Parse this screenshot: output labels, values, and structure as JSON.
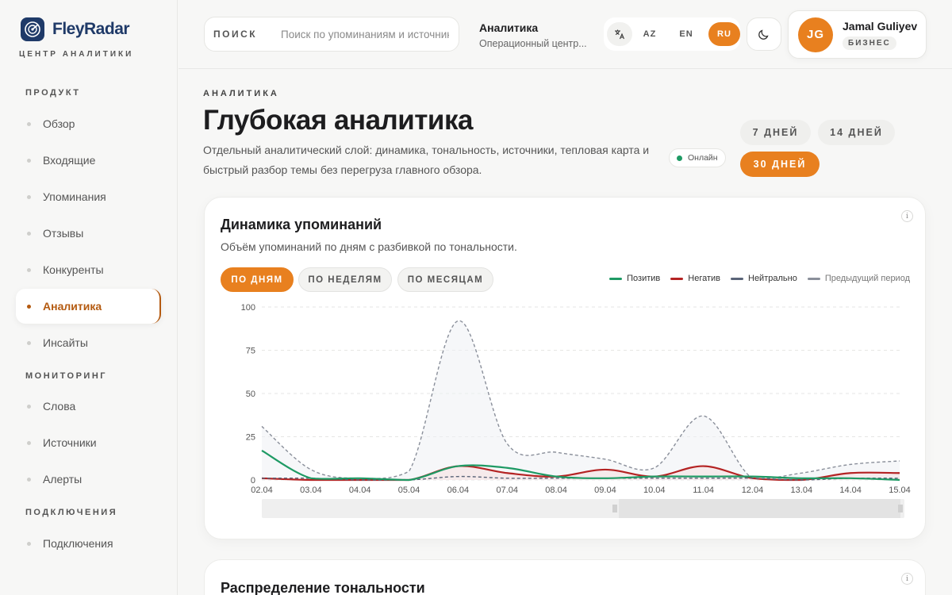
{
  "brand": {
    "name": "FleyRadar",
    "subtitle": "ЦЕНТР АНАЛИТИКИ"
  },
  "sidebar": {
    "sections": [
      {
        "label": "ПРОДУКТ",
        "items": [
          "Обзор",
          "Входящие",
          "Упоминания",
          "Отзывы",
          "Конкуренты",
          "Аналитика",
          "Инсайты"
        ]
      },
      {
        "label": "МОНИТОРИНГ",
        "items": [
          "Слова",
          "Источники",
          "Алерты"
        ]
      },
      {
        "label": "ПОДКЛЮЧЕНИЯ",
        "items": [
          "Подключения"
        ]
      }
    ],
    "active": "Аналитика"
  },
  "header": {
    "search": {
      "label": "ПОИСК",
      "placeholder": "Поиск по упоминаниям и источникам"
    },
    "context_title": "Аналитика",
    "context_sub": "Операционный центр...",
    "languages": [
      "AZ",
      "EN",
      "RU"
    ],
    "active_language": "RU",
    "user": {
      "initials": "JG",
      "name": "Jamal Guliyev",
      "plan": "БИЗНЕС"
    }
  },
  "page": {
    "eyebrow": "АНАЛИТИКА",
    "title": "Глубокая аналитика",
    "description": "Отдельный аналитический слой: динамика, тональность, источники, тепловая карта и быстрый разбор темы без перегруза главного обзора.",
    "status": "Онлайн",
    "ranges": [
      "7 ДНЕЙ",
      "14 ДНЕЙ",
      "30 ДНЕЙ"
    ],
    "active_range": "30 ДНЕЙ"
  },
  "dynamics_card": {
    "title": "Динамика упоминаний",
    "subtitle": "Объём упоминаний по дням с разбивкой по тональности.",
    "tabs": [
      "ПО ДНЯМ",
      "ПО НЕДЕЛЯМ",
      "ПО МЕСЯЦАМ"
    ],
    "active_tab": "ПО ДНЯМ"
  },
  "second_card": {
    "title": "Распределение тональности"
  },
  "colors": {
    "accent": "#e8801f",
    "positive": "#1e9a64",
    "negative": "#b42323",
    "neutral": "#5a6478",
    "previous": "#8a8f9a"
  },
  "chart_data": {
    "type": "line",
    "x": [
      "02.04",
      "03.04",
      "04.04",
      "05.04",
      "06.04",
      "07.04",
      "08.04",
      "09.04",
      "10.04",
      "11.04",
      "12.04",
      "13.04",
      "14.04",
      "15.04"
    ],
    "ylim": [
      0,
      100
    ],
    "yticks": [
      0,
      25,
      50,
      75,
      100
    ],
    "series": [
      {
        "name": "Позитив",
        "color": "#1e9a64",
        "dashed": false,
        "values": [
          17,
          1,
          1,
          0,
          8,
          7,
          2,
          1,
          2,
          2,
          2,
          1,
          1,
          0
        ]
      },
      {
        "name": "Негатив",
        "color": "#b42323",
        "dashed": false,
        "values": [
          1,
          0,
          0,
          0,
          8,
          4,
          2,
          6,
          2,
          8,
          1,
          0,
          4,
          4
        ]
      },
      {
        "name": "Нейтрально",
        "color": "#5a6478",
        "dashed": true,
        "values": [
          1,
          1,
          0,
          0,
          2,
          1,
          1,
          1,
          1,
          1,
          1,
          0,
          1,
          1
        ]
      },
      {
        "name": "Предыдущий период",
        "color": "#8a8f9a",
        "dashed": true,
        "values": [
          31,
          6,
          1,
          5,
          92,
          21,
          16,
          12,
          7,
          37,
          1,
          4,
          9,
          11
        ]
      }
    ],
    "grid": true,
    "legend": "top-right"
  }
}
